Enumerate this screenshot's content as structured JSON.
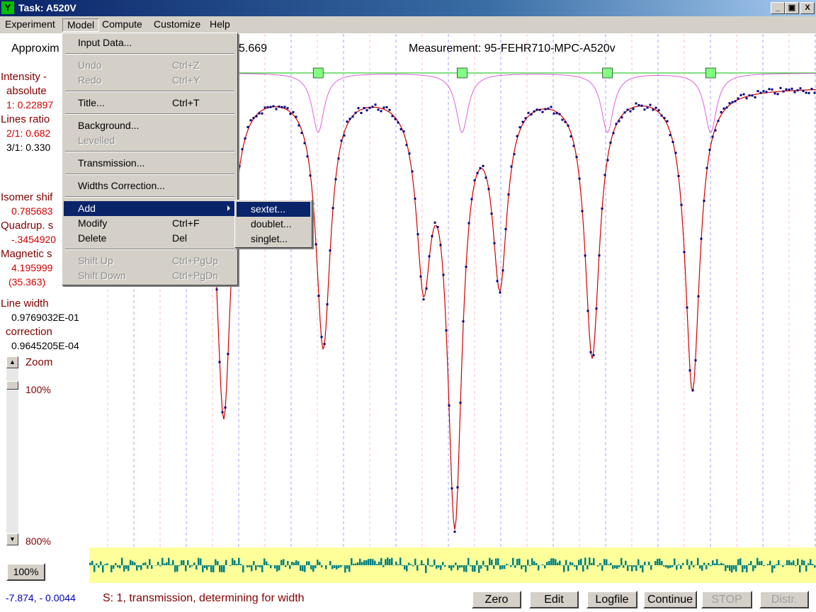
{
  "window": {
    "title": "Task: A520V",
    "icon_glyph": "Υ",
    "controls": {
      "minimize": "_",
      "restore": "▣",
      "close": "X"
    }
  },
  "menubar": [
    "Experiment",
    "Model",
    "Compute",
    "Customize",
    "Help"
  ],
  "header": {
    "approx_prefix": "Approxim",
    "approx_suffix": "5.669",
    "measurement": "Measurement: 95-FEHR710-MPC-A520v"
  },
  "left_panel": {
    "intensity_label": "Intensity -",
    "absolute_label": "absolute",
    "intensity_value": "1:  0.22897",
    "lines_ratio_label": "Lines ratio",
    "ratio_2": "2/1:   0.682",
    "ratio_3": "3/1:   0.330",
    "isomer_label": "Isomer shif",
    "isomer_value": "0.785683",
    "quadrup_label": "Quadrup. s",
    "quadrup_value": "-.3454920",
    "magnetic_label": "Magnetic s",
    "magnetic_value": "4.195999",
    "magnetic_paren": "(35.363)",
    "line_width_label": "Line width",
    "line_width_value": "0.9769032E-01",
    "correction_label": "correction",
    "correction_value": "0.9645205E-04"
  },
  "zoom": {
    "label": "Zoom",
    "top_value": "100%",
    "bottom_value": "800%",
    "reset_button": "100%",
    "level": 0.0
  },
  "status": {
    "coords": "-7.874, - 0.0044",
    "message": "S:  1, transmission, determining for width"
  },
  "buttons": [
    "Zero",
    "Edit",
    "Logfile",
    "Continue",
    "STOP",
    "Distr."
  ],
  "model_menu": {
    "items": [
      {
        "label": "Input Data...",
        "shortcut": "",
        "disabled": false
      },
      {
        "label": "Undo",
        "shortcut": "Ctrl+Z",
        "disabled": true
      },
      {
        "label": "Redo",
        "shortcut": "Ctrl+Y",
        "disabled": true
      },
      {
        "label": "Title...",
        "shortcut": "Ctrl+T",
        "disabled": false
      },
      {
        "label": "Background...",
        "shortcut": "",
        "disabled": false
      },
      {
        "label": "Levelled",
        "shortcut": "",
        "disabled": true
      },
      {
        "label": "Transmission...",
        "shortcut": "",
        "disabled": false
      },
      {
        "label": "Widths Correction...",
        "shortcut": "",
        "disabled": false
      },
      {
        "label": "Add",
        "shortcut": "",
        "disabled": false
      },
      {
        "label": "Modify",
        "shortcut": "Ctrl+F",
        "disabled": false
      },
      {
        "label": "Delete",
        "shortcut": "Del",
        "disabled": false
      },
      {
        "label": "Shift Up",
        "shortcut": "Ctrl+PgUp",
        "disabled": true
      },
      {
        "label": "Shift Down",
        "shortcut": "Ctrl+PgDn",
        "disabled": true
      }
    ],
    "add_submenu": [
      "sextet...",
      "doublet...",
      "singlet..."
    ]
  },
  "colors": {
    "fit_line": "#d00000",
    "data_points": "#000080",
    "baseline": "#00c000",
    "subspectrum": "#e060e0",
    "marker": "#80ff80",
    "residual_bg": "#ffff99",
    "residual_bars": "#008080",
    "grid_red": "#ff8080",
    "grid_blue": "#4040ff"
  },
  "chart_data": {
    "type": "scatter",
    "baseline": 0,
    "lines": [
      {
        "pos": 0.185,
        "depth": 0.72
      },
      {
        "pos": 0.322,
        "depth": 0.56
      },
      {
        "pos": 0.46,
        "depth": 0.38
      },
      {
        "pos": 0.503,
        "depth": 0.92
      },
      {
        "pos": 0.565,
        "depth": 0.4
      },
      {
        "pos": 0.692,
        "depth": 0.58
      },
      {
        "pos": 0.83,
        "depth": 0.66
      }
    ],
    "markers": [
      0.315,
      0.513,
      0.713,
      0.855
    ]
  }
}
